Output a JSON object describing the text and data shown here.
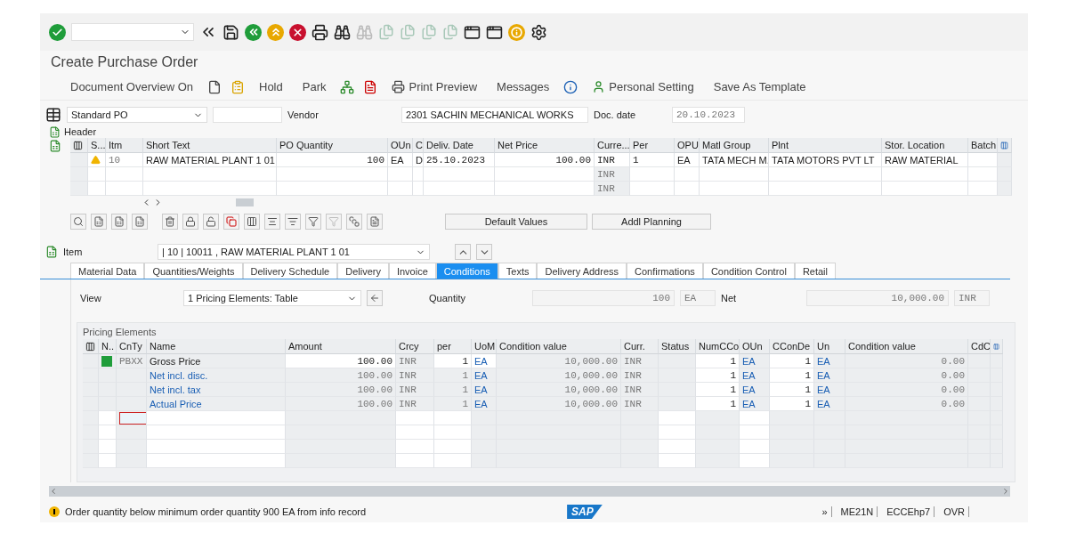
{
  "window": {
    "title": "Create Purchase Order"
  },
  "app_toolbar": [
    {
      "label": "Document Overview On"
    },
    {
      "label": "Hold"
    },
    {
      "label": "Park"
    },
    {
      "label": "Print Preview"
    },
    {
      "label": "Messages"
    },
    {
      "label": "Personal Setting"
    },
    {
      "label": "Save As Template"
    }
  ],
  "header": {
    "doc_type": "Standard PO",
    "vendor_label": "Vendor",
    "vendor": "2301 SACHIN MECHANICAL WORKS",
    "doc_date_label": "Doc. date",
    "doc_date": "20.10.2023",
    "section_label": "Header"
  },
  "items_table": {
    "columns": [
      "S...",
      "Itm",
      "Short Text",
      "PO Quantity",
      "OUn",
      "C",
      "Deliv. Date",
      "Net Price",
      "Curre...",
      "Per",
      "OPU",
      "Matl Group",
      "Plnt",
      "Stor. Location",
      "Batch"
    ],
    "rows": [
      {
        "warning": true,
        "item": "10",
        "short_text": "RAW MATERIAL PLANT 1 01",
        "po_quantity": "100",
        "oun": "EA",
        "c": "D",
        "deliv_date": "25.10.2023",
        "net_price": "100.00",
        "currency": "INR",
        "per": "1",
        "opu": "EA",
        "matl_group": "TATA MECH M.",
        "plant": "TATA MOTORS PVT LT",
        "stor_location": "RAW MATERIAL"
      },
      {
        "warning": false,
        "currency": "INR"
      },
      {
        "warning": false,
        "currency": "INR"
      }
    ],
    "buttons": [
      "Default Values",
      "Addl Planning"
    ]
  },
  "item_selector": {
    "label": "Item",
    "value": "| 10 | 10011 , RAW MATERIAL PLANT 1 01"
  },
  "tabs": [
    {
      "label": "Material Data",
      "selected": false
    },
    {
      "label": "Quantities/Weights",
      "selected": false
    },
    {
      "label": "Delivery Schedule",
      "selected": false
    },
    {
      "label": "Delivery",
      "selected": false
    },
    {
      "label": "Invoice",
      "selected": false
    },
    {
      "label": "Conditions",
      "selected": true
    },
    {
      "label": "Texts",
      "selected": false
    },
    {
      "label": "Delivery Address",
      "selected": false
    },
    {
      "label": "Confirmations",
      "selected": false
    },
    {
      "label": "Condition Control",
      "selected": false
    },
    {
      "label": "Retail",
      "selected": false
    }
  ],
  "conditions": {
    "view_label": "View",
    "view": "1 Pricing Elements: Table",
    "quantity_label": "Quantity",
    "quantity": "100",
    "quantity_unit": "EA",
    "net_label": "Net",
    "net": "10,000.00",
    "net_currency": "INR",
    "group_title": "Pricing Elements",
    "columns": [
      "N..",
      "CnTy",
      "Name",
      "Amount",
      "Crcy",
      "per",
      "UoM",
      "Condition value",
      "Curr.",
      "Status",
      "NumCCo",
      "OUn",
      "CConDe",
      "Un",
      "Condition value",
      "CdC"
    ],
    "rows": [
      {
        "kind": "condition",
        "cnty": "PBXX",
        "name": "Gross Price",
        "amount": "100.00",
        "crcy": "INR",
        "per": "1",
        "uom": "EA",
        "value": "10,000.00",
        "curr": "INR",
        "numcco": "1",
        "oun": "EA",
        "cconde": "1",
        "un": "EA",
        "value_2": "0.00"
      },
      {
        "kind": "subtotal",
        "name": "Net incl. disc.",
        "amount": "100.00",
        "crcy": "INR",
        "per": "1",
        "uom": "EA",
        "value": "10,000.00",
        "curr": "INR",
        "numcco": "1",
        "oun": "EA",
        "cconde": "1",
        "un": "EA",
        "value_2": "0.00"
      },
      {
        "kind": "subtotal",
        "name": "Net incl. tax",
        "amount": "100.00",
        "crcy": "INR",
        "per": "1",
        "uom": "EA",
        "value": "10,000.00",
        "curr": "INR",
        "numcco": "1",
        "oun": "EA",
        "cconde": "1",
        "un": "EA",
        "value_2": "0.00"
      },
      {
        "kind": "subtotal",
        "name": "Actual Price",
        "amount": "100.00",
        "crcy": "INR",
        "per": "1",
        "uom": "EA",
        "value": "10,000.00",
        "curr": "INR",
        "numcco": "1",
        "oun": "EA",
        "cconde": "1",
        "un": "EA",
        "value_2": "0.00"
      }
    ]
  },
  "status_bar": {
    "message": "Order quantity below minimum order quantity 900 EA from info record",
    "logo": "SAP",
    "more": "»",
    "transaction": "ME21N",
    "system": "ECCEhp7",
    "mode": "OVR"
  }
}
